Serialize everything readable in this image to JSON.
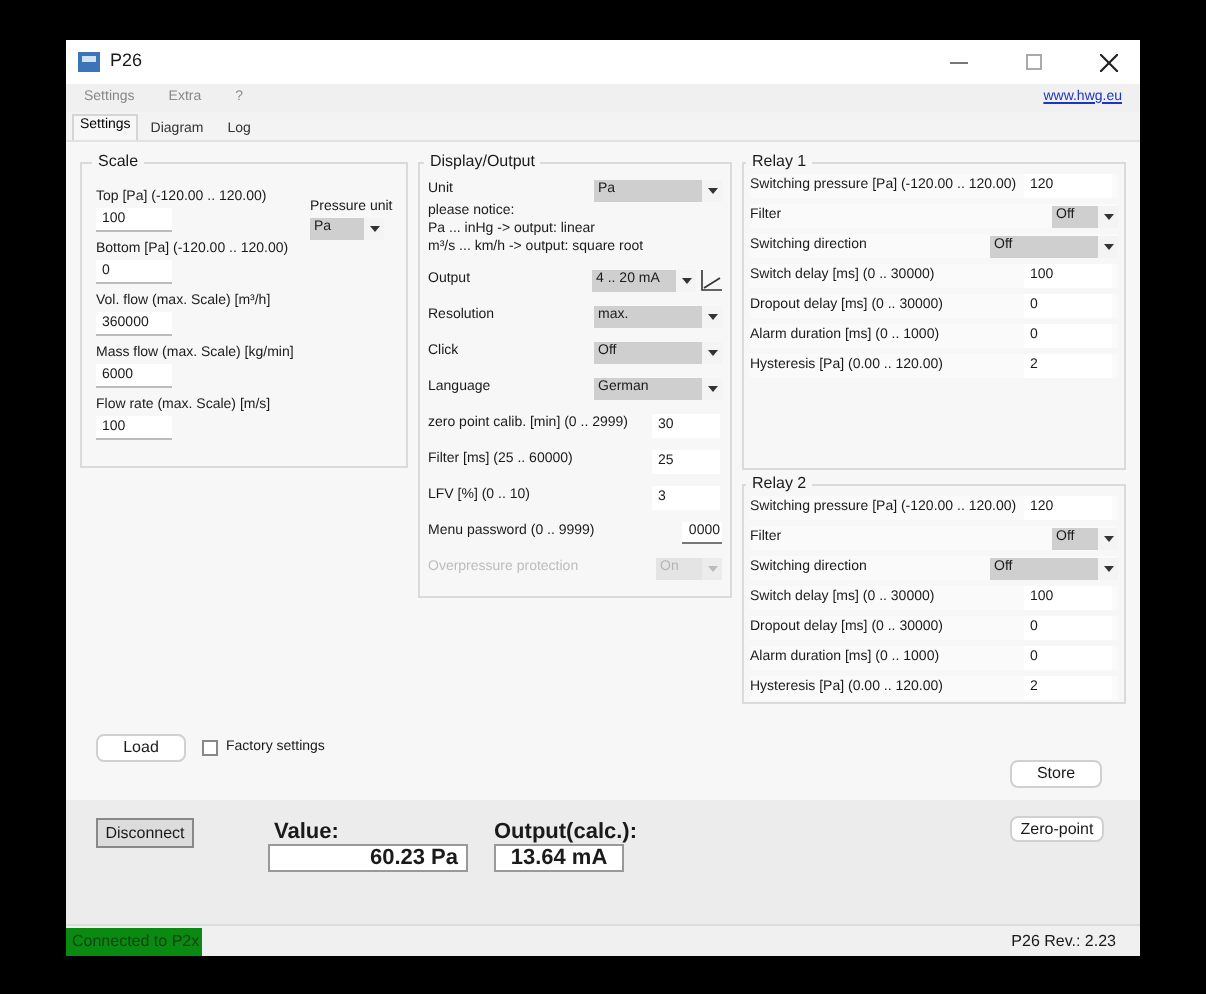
{
  "window": {
    "title": "P26"
  },
  "menu": [
    "Settings",
    "Extra",
    "?"
  ],
  "link": "www.hwg.eu",
  "tabs": [
    {
      "label": "Settings",
      "selected": true
    },
    {
      "label": "Diagram",
      "selected": false
    },
    {
      "label": "Log",
      "selected": false
    }
  ],
  "scale": {
    "title": "Scale",
    "fields": [
      {
        "label": "Top [Pa] (-120.00 .. 120.00)",
        "value": "100"
      },
      {
        "label": "Bottom [Pa] (-120.00 .. 120.00)",
        "value": "0"
      },
      {
        "label": "Vol. flow (max. Scale) [m³/h]",
        "value": "360000"
      },
      {
        "label": "Mass flow (max. Scale) [kg/min]",
        "value": "6000"
      },
      {
        "label": "Flow rate (max. Scale) [m/s]",
        "value": "100"
      }
    ],
    "pressure_unit": {
      "label": "Pressure unit",
      "value": "Pa"
    }
  },
  "display_output": {
    "title": "Display/Output",
    "unit": {
      "label": "Unit",
      "value": "Pa"
    },
    "notice": [
      "please notice:",
      "Pa ... inHg -> output: linear",
      "m³/s ... km/h -> output: square root"
    ],
    "rows": [
      {
        "kind": "select",
        "label": "Output",
        "value": "4 .. 20 mA",
        "disabled": false,
        "graph": true
      },
      {
        "kind": "select",
        "label": "Resolution",
        "value": "max.",
        "disabled": false,
        "graph": false
      },
      {
        "kind": "select",
        "label": "Click",
        "value": "Off",
        "disabled": false,
        "graph": false
      },
      {
        "kind": "select",
        "label": "Language",
        "value": "German",
        "disabled": false,
        "graph": false
      },
      {
        "kind": "input",
        "label": "zero point calib. [min]  (0 .. 2999)",
        "value": "30",
        "disabled": false
      },
      {
        "kind": "input",
        "label": "Filter [ms]  (25 .. 60000)",
        "value": "25",
        "disabled": false
      },
      {
        "kind": "input",
        "label": "LFV [%]  (0 .. 10)",
        "value": "3",
        "disabled": false
      },
      {
        "kind": "line",
        "label": "Menu password  (0 .. 9999)",
        "value": "0000",
        "disabled": false
      },
      {
        "kind": "select",
        "label": "Overpressure protection",
        "value": "On",
        "disabled": true,
        "graph": false
      }
    ]
  },
  "relays": [
    {
      "title": "Relay 1",
      "rows": [
        {
          "kind": "input",
          "label": "Switching pressure [Pa] (-120.00 .. 120.00)",
          "value": "120"
        },
        {
          "kind": "select",
          "label": "Filter",
          "value": "Off"
        },
        {
          "kind": "wideselect",
          "label": "Switching direction",
          "value": "Off"
        },
        {
          "kind": "input",
          "label": "Switch delay [ms]  (0 .. 30000)",
          "value": "100"
        },
        {
          "kind": "input",
          "label": "Dropout delay [ms]  (0 .. 30000)",
          "value": "0"
        },
        {
          "kind": "input",
          "label": "Alarm duration [ms]  (0 .. 1000)",
          "value": "0"
        },
        {
          "kind": "input",
          "label": "Hysteresis [Pa] (0.00 .. 120.00)",
          "value": "2"
        }
      ]
    },
    {
      "title": "Relay 2",
      "rows": [
        {
          "kind": "input",
          "label": "Switching pressure [Pa] (-120.00 .. 120.00)",
          "value": "120"
        },
        {
          "kind": "select",
          "label": "Filter",
          "value": "Off"
        },
        {
          "kind": "wideselect",
          "label": "Switching direction",
          "value": "Off"
        },
        {
          "kind": "input",
          "label": "Switch delay [ms]  (0 .. 30000)",
          "value": "100"
        },
        {
          "kind": "input",
          "label": "Dropout delay [ms]  (0 .. 30000)",
          "value": "0"
        },
        {
          "kind": "input",
          "label": "Alarm duration [ms]  (0 .. 1000)",
          "value": "0"
        },
        {
          "kind": "input",
          "label": "Hysteresis [Pa] (0.00 .. 120.00)",
          "value": "2"
        }
      ]
    }
  ],
  "load_button": "Load",
  "factory_settings": {
    "label": "Factory settings",
    "checked": false
  },
  "store_button": "Store",
  "disconnect_button": "Disconnect",
  "value": {
    "label": "Value:",
    "reading": "60.23 Pa"
  },
  "output": {
    "label": "Output(calc.):",
    "reading": "13.64 mA"
  },
  "zero_point_button": "Zero-point",
  "status_bar": {
    "connection": "Connected to P2x",
    "revision": "P26 Rev.: 2.23"
  }
}
